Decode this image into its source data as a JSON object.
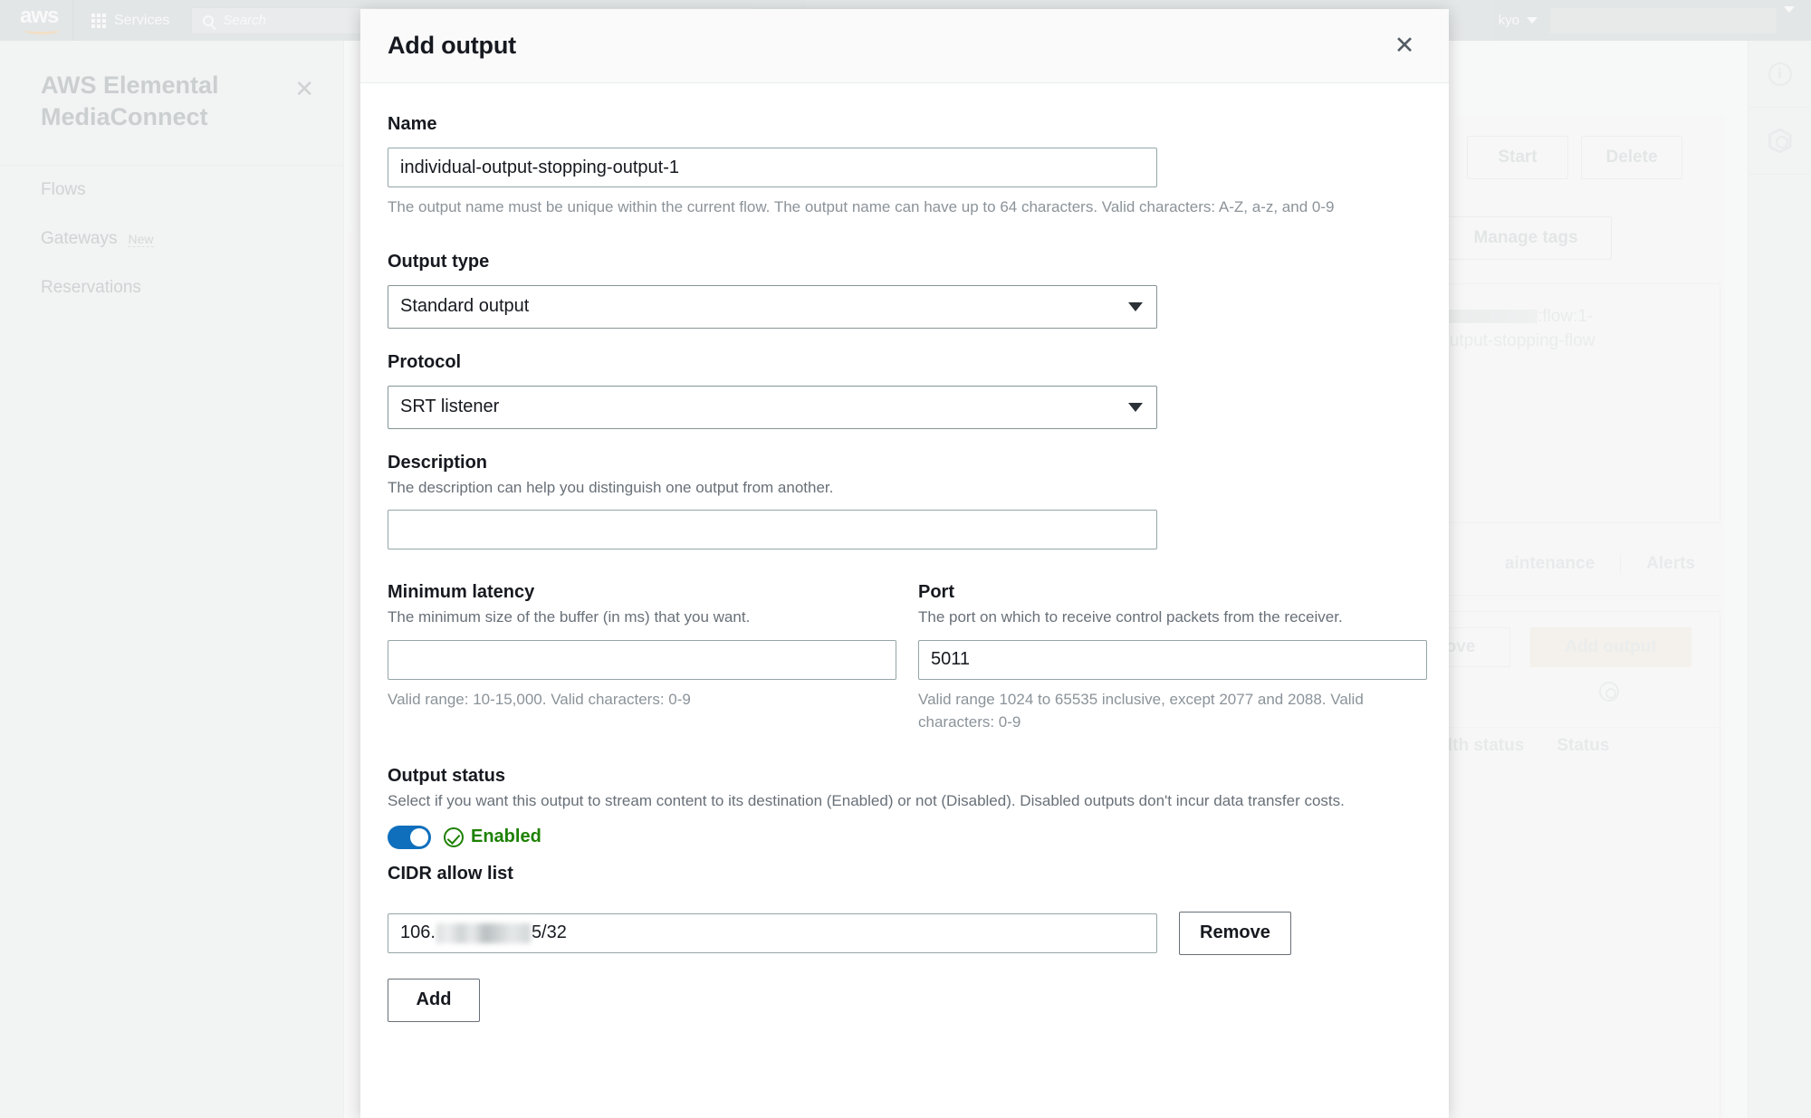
{
  "background": {
    "topnav": {
      "logo": "aws",
      "services_label": "Services",
      "search_placeholder": "Search",
      "region_label": "kyo"
    },
    "sidebar": {
      "title": "AWS Elemental MediaConnect",
      "items": [
        {
          "label": "Flows",
          "badge": ""
        },
        {
          "label": "Gateways",
          "badge": "New"
        },
        {
          "label": "Reservations",
          "badge": ""
        }
      ]
    },
    "actions": {
      "start_label": "Start",
      "delete_label": "Delete",
      "manage_tags_label": "Manage tags"
    },
    "arn": {
      "line1_suffix": ":flow:1-",
      "line2": "dual-output-stopping-flow"
    },
    "tabs": [
      {
        "label": "aintenance"
      },
      {
        "label": "Alerts"
      }
    ],
    "outputs": {
      "remove_label": "ove",
      "add_output_label": "Add output",
      "columns": [
        "Health status",
        "Status"
      ]
    }
  },
  "modal": {
    "title": "Add output",
    "close_label": "✕",
    "name": {
      "label": "Name",
      "value": "individual-output-stopping-output-1",
      "hint": "The output name must be unique within the current flow. The output name can have up to 64 characters. Valid characters: A-Z, a-z, and 0-9"
    },
    "output_type": {
      "label": "Output type",
      "value": "Standard output"
    },
    "protocol": {
      "label": "Protocol",
      "value": "SRT listener"
    },
    "description": {
      "label": "Description",
      "desc": "The description can help you distinguish one output from another.",
      "value": "",
      "placeholder": ""
    },
    "minimum_latency": {
      "label": "Minimum latency",
      "desc": "The minimum size of the buffer (in ms) that you want.",
      "value": "",
      "hint": "Valid range: 10-15,000. Valid characters: 0-9"
    },
    "port": {
      "label": "Port",
      "desc": "The port on which to receive control packets from the receiver.",
      "value": "5011",
      "hint": "Valid range 1024 to 65535 inclusive, except 2077 and 2088. Valid characters: 0-9"
    },
    "output_status": {
      "label": "Output status",
      "desc": "Select if you want this output to stream content to its destination (Enabled) or not (Disabled). Disabled outputs don't incur data transfer costs.",
      "toggle_on": true,
      "status_label": "Enabled"
    },
    "cidr_allow_list": {
      "label": "CIDR allow list",
      "value_prefix": "106.",
      "value_suffix": "5/32",
      "remove_label": "Remove",
      "add_label": "Add"
    }
  },
  "colors": {
    "accent_blue": "#0f6fbd",
    "status_green": "#1d8102",
    "text_primary": "#16191f",
    "text_secondary": "#687078",
    "border": "#95a5a6"
  }
}
